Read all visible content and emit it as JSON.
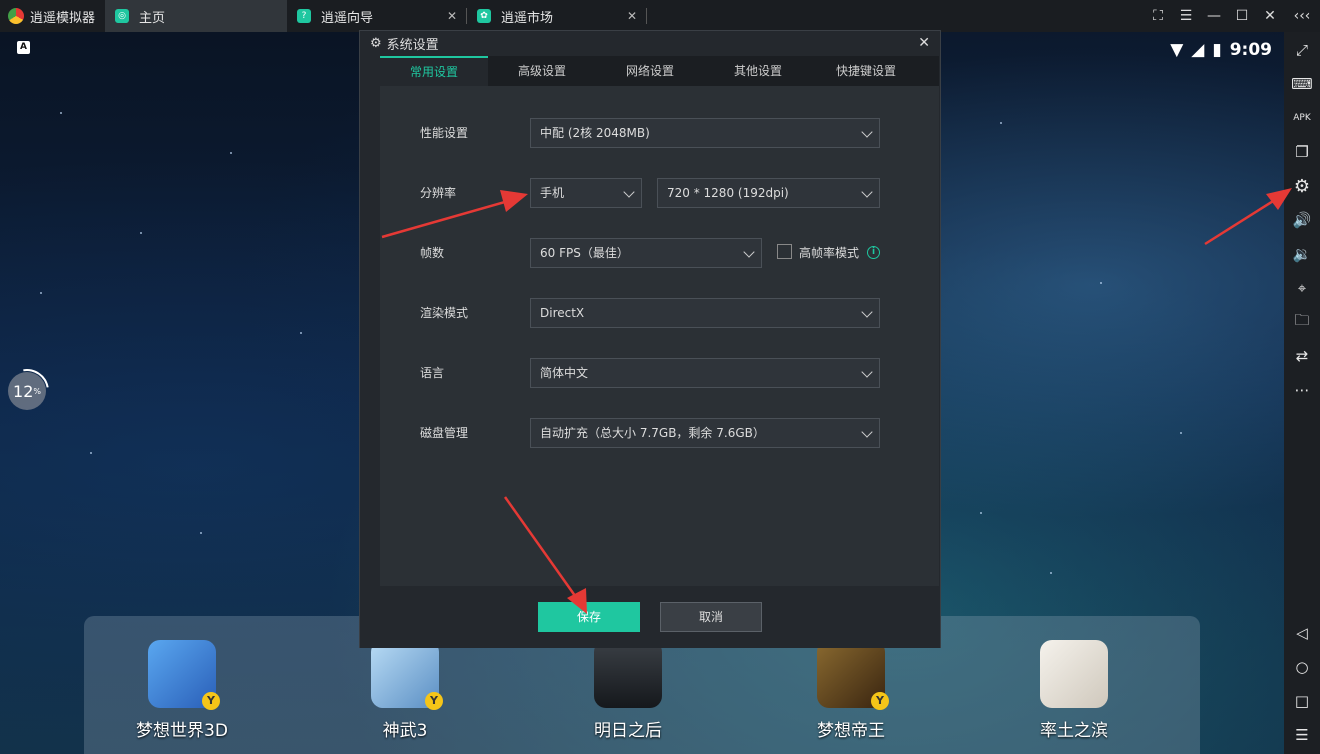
{
  "titlebar": {
    "app_name": "逍遥模拟器",
    "tabs": [
      {
        "label": "主页",
        "icon": "home-icon",
        "active": true
      },
      {
        "label": "逍遥向导",
        "icon": "help-icon",
        "active": false
      },
      {
        "label": "逍遥市场",
        "icon": "market-icon",
        "active": false
      }
    ],
    "controls": [
      "screenshot-icon",
      "menu-icon",
      "minimize-icon",
      "maximize-icon",
      "close-icon",
      "collapse-icon"
    ]
  },
  "status": {
    "clock": "9:09",
    "a_badge": "A",
    "progress": "12",
    "progress_unit": "%"
  },
  "dialog": {
    "title": "系统设置",
    "tabs": [
      "常用设置",
      "高级设置",
      "网络设置",
      "其他设置",
      "快捷键设置"
    ],
    "active_tab": "常用设置",
    "rows": {
      "performance": {
        "label": "性能设置",
        "value": "中配 (2核 2048MB)"
      },
      "resolution": {
        "label": "分辨率",
        "device": "手机",
        "value": "720 * 1280 (192dpi)"
      },
      "fps": {
        "label": "帧数",
        "value": "60 FPS（最佳）",
        "checkbox_label": "高帧率模式"
      },
      "render": {
        "label": "渲染模式",
        "value": "DirectX"
      },
      "language": {
        "label": "语言",
        "value": "简体中文"
      },
      "disk": {
        "label": "磁盘管理",
        "value": "自动扩充（总大小 7.7GB，剩余 7.6GB）"
      }
    },
    "save_label": "保存",
    "cancel_label": "取消"
  },
  "dock": {
    "apps": [
      {
        "label": "梦想世界3D",
        "color": "#3a7bd5"
      },
      {
        "label": "神武3",
        "color": "#7fb3e0"
      },
      {
        "label": "明日之后",
        "color": "#2a2e33"
      },
      {
        "label": "梦想帝王",
        "color": "#6b4a20"
      },
      {
        "label": "率土之滨",
        "color": "#e8e4dc"
      }
    ]
  },
  "sidebar": {
    "items": [
      "fullscreen-icon",
      "keyboard-icon",
      "apk-icon",
      "multi-window-icon",
      "settings-icon",
      "volume-up-icon",
      "volume-down-icon",
      "location-icon",
      "folder-icon",
      "rotate-icon",
      "more-icon",
      "back-icon",
      "home-nav-icon",
      "recent-icon",
      "list-icon"
    ]
  },
  "colors": {
    "accent": "#1fc7a0",
    "arrow": "#e53935"
  }
}
